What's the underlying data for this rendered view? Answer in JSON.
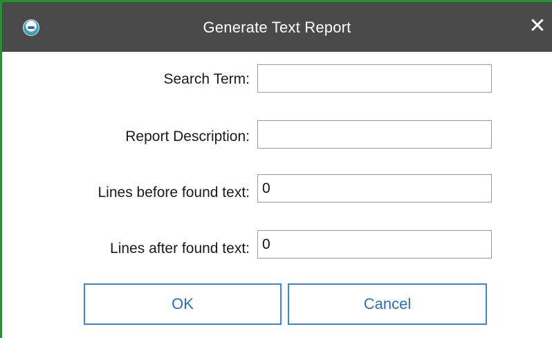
{
  "window": {
    "title": "Generate Text Report",
    "close_glyph": "✕",
    "app_icon": "app-logo-icon",
    "border_color": "#2e8b3a",
    "titlebar_color": "#4a4a4a"
  },
  "form": {
    "search_term": {
      "label": "Search Term:",
      "value": ""
    },
    "report_description": {
      "label": "Report Description:",
      "value": ""
    },
    "lines_before": {
      "label": "Lines before found text:",
      "value": "0"
    },
    "lines_after": {
      "label": "Lines after found text:",
      "value": "0"
    }
  },
  "buttons": {
    "ok": "OK",
    "cancel": "Cancel",
    "accent_color": "#3a86d4"
  }
}
